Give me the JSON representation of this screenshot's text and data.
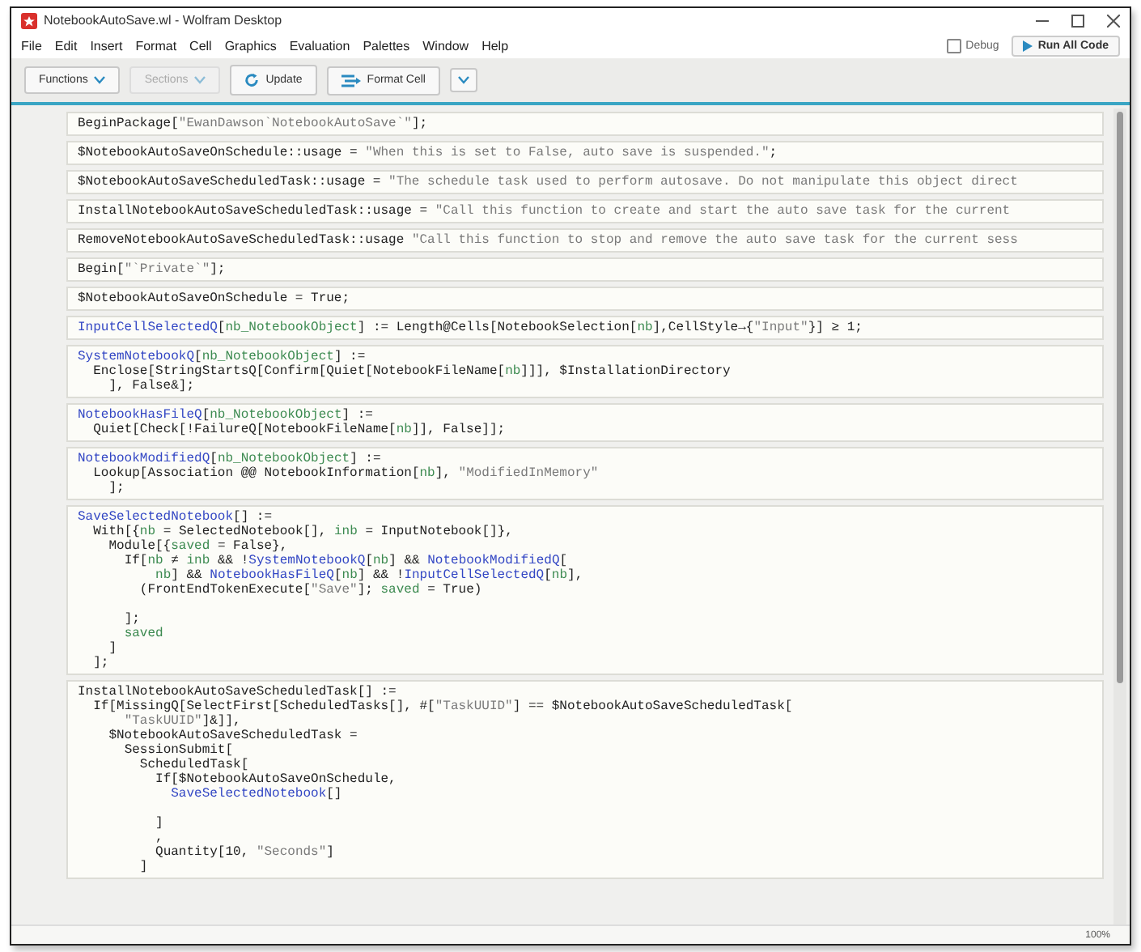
{
  "window": {
    "title": "NotebookAutoSave.wl - Wolfram Desktop"
  },
  "menu": [
    "File",
    "Edit",
    "Insert",
    "Format",
    "Cell",
    "Graphics",
    "Evaluation",
    "Palettes",
    "Window",
    "Help"
  ],
  "toolbar": {
    "buttons": [
      {
        "label": "Functions",
        "kind": "dropdown",
        "disabled": false
      },
      {
        "label": "Sections",
        "kind": "dropdown",
        "disabled": true
      },
      {
        "label": "Update",
        "kind": "refresh",
        "disabled": false
      },
      {
        "label": "Format Cell",
        "kind": "format",
        "disabled": false
      },
      {
        "kind": "chevron",
        "disabled": false
      }
    ],
    "debug": {
      "label": "Debug",
      "checked": false
    },
    "run_button": "Run All Code"
  },
  "cells": [
    {
      "lines": [
        [
          {
            "text": "BeginPackage[",
            "kind": "plain"
          },
          {
            "text": "\"EwanDawson`NotebookAutoSave`\"",
            "kind": "str"
          },
          {
            "text": "];",
            "kind": "plain"
          }
        ]
      ]
    },
    {
      "lines": [
        [
          {
            "text": "$NotebookAutoSaveOnSchedule::usage = ",
            "kind": "plain"
          },
          {
            "text": "\"When this is set to False, auto save is suspended.\"",
            "kind": "str"
          },
          {
            "text": ";",
            "kind": "plain"
          }
        ]
      ]
    },
    {
      "lines": [
        [
          {
            "text": "$NotebookAutoSaveScheduledTask::usage = ",
            "kind": "plain"
          },
          {
            "text": "\"The schedule task used to perform autosave. Do not manipulate this object direct",
            "kind": "str"
          }
        ]
      ]
    },
    {
      "lines": [
        [
          {
            "text": "InstallNotebookAutoSaveScheduledTask::usage = ",
            "kind": "plain"
          },
          {
            "text": "\"Call this function to create and start the auto save task for the current",
            "kind": "str"
          }
        ]
      ]
    },
    {
      "lines": [
        [
          {
            "text": "RemoveNotebookAutoSaveScheduledTask::usage ",
            "kind": "plain"
          },
          {
            "text": "\"Call this function to stop and remove the auto save task for the current sess",
            "kind": "str"
          }
        ]
      ]
    },
    {
      "lines": [
        [
          {
            "text": "Begin[",
            "kind": "plain"
          },
          {
            "text": "\"`Private`\"",
            "kind": "str"
          },
          {
            "text": "];",
            "kind": "plain"
          }
        ]
      ]
    },
    {
      "lines": [
        [
          {
            "text": "$NotebookAutoSaveOnSchedule = True;",
            "kind": "plain"
          }
        ]
      ]
    },
    {
      "lines": [
        [
          {
            "text": "InputCellSelectedQ",
            "kind": "def"
          },
          {
            "text": "[",
            "kind": "plain"
          },
          {
            "text": "nb_NotebookObject",
            "kind": "var"
          },
          {
            "text": "] := Length@Cells[NotebookSelection[",
            "kind": "plain"
          },
          {
            "text": "nb",
            "kind": "var"
          },
          {
            "text": "],CellStyle→{",
            "kind": "plain"
          },
          {
            "text": "\"Input\"",
            "kind": "str"
          },
          {
            "text": "}] ≥ 1;",
            "kind": "plain"
          }
        ]
      ]
    },
    {
      "lines": [
        [
          {
            "text": "SystemNotebookQ",
            "kind": "def"
          },
          {
            "text": "[",
            "kind": "plain"
          },
          {
            "text": "nb_NotebookObject",
            "kind": "var"
          },
          {
            "text": "] :=",
            "kind": "plain"
          }
        ],
        [
          {
            "text": "  Enclose[StringStartsQ[Confirm[Quiet[NotebookFileName[",
            "kind": "plain"
          },
          {
            "text": "nb",
            "kind": "var"
          },
          {
            "text": "]]], $InstallationDirectory",
            "kind": "plain"
          }
        ],
        [
          {
            "text": "    ], False&];",
            "kind": "plain"
          }
        ]
      ]
    },
    {
      "lines": [
        [
          {
            "text": "NotebookHasFileQ",
            "kind": "def"
          },
          {
            "text": "[",
            "kind": "plain"
          },
          {
            "text": "nb_NotebookObject",
            "kind": "var"
          },
          {
            "text": "] :=",
            "kind": "plain"
          }
        ],
        [
          {
            "text": "  Quiet[Check[!FailureQ[NotebookFileName[",
            "kind": "plain"
          },
          {
            "text": "nb",
            "kind": "var"
          },
          {
            "text": "]], False]];",
            "kind": "plain"
          }
        ]
      ]
    },
    {
      "lines": [
        [
          {
            "text": "NotebookModifiedQ",
            "kind": "def"
          },
          {
            "text": "[",
            "kind": "plain"
          },
          {
            "text": "nb_NotebookObject",
            "kind": "var"
          },
          {
            "text": "] :=",
            "kind": "plain"
          }
        ],
        [
          {
            "text": "  Lookup[Association @@ NotebookInformation[",
            "kind": "plain"
          },
          {
            "text": "nb",
            "kind": "var"
          },
          {
            "text": "], ",
            "kind": "plain"
          },
          {
            "text": "\"ModifiedInMemory\"",
            "kind": "str"
          }
        ],
        [
          {
            "text": "    ];",
            "kind": "plain"
          }
        ]
      ]
    },
    {
      "lines": [
        [
          {
            "text": "SaveSelectedNotebook",
            "kind": "def"
          },
          {
            "text": "[] :=",
            "kind": "plain"
          }
        ],
        [
          {
            "text": "  With[{",
            "kind": "plain"
          },
          {
            "text": "nb",
            "kind": "var"
          },
          {
            "text": " = SelectedNotebook[], ",
            "kind": "plain"
          },
          {
            "text": "inb",
            "kind": "var"
          },
          {
            "text": " = InputNotebook[]},",
            "kind": "plain"
          }
        ],
        [
          {
            "text": "    Module[{",
            "kind": "plain"
          },
          {
            "text": "saved",
            "kind": "var"
          },
          {
            "text": " = False},",
            "kind": "plain"
          }
        ],
        [
          {
            "text": "      If[",
            "kind": "plain"
          },
          {
            "text": "nb",
            "kind": "var"
          },
          {
            "text": " ≠ ",
            "kind": "plain"
          },
          {
            "text": "inb",
            "kind": "var"
          },
          {
            "text": " && !",
            "kind": "plain"
          },
          {
            "text": "SystemNotebookQ",
            "kind": "def"
          },
          {
            "text": "[",
            "kind": "plain"
          },
          {
            "text": "nb",
            "kind": "var"
          },
          {
            "text": "] && ",
            "kind": "plain"
          },
          {
            "text": "NotebookModifiedQ",
            "kind": "def"
          },
          {
            "text": "[",
            "kind": "plain"
          }
        ],
        [
          {
            "text": "          nb",
            "kind": "var"
          },
          {
            "text": "] && ",
            "kind": "plain"
          },
          {
            "text": "NotebookHasFileQ",
            "kind": "def"
          },
          {
            "text": "[",
            "kind": "plain"
          },
          {
            "text": "nb",
            "kind": "var"
          },
          {
            "text": "] && !",
            "kind": "plain"
          },
          {
            "text": "InputCellSelectedQ",
            "kind": "def"
          },
          {
            "text": "[",
            "kind": "plain"
          },
          {
            "text": "nb",
            "kind": "var"
          },
          {
            "text": "],",
            "kind": "plain"
          }
        ],
        [
          {
            "text": "        (FrontEndTokenExecute[",
            "kind": "plain"
          },
          {
            "text": "\"Save\"",
            "kind": "str"
          },
          {
            "text": "]; ",
            "kind": "plain"
          },
          {
            "text": "saved",
            "kind": "var"
          },
          {
            "text": " = True)",
            "kind": "plain"
          }
        ],
        [
          {
            "kind": "blank"
          }
        ],
        [
          {
            "text": "      ];",
            "kind": "plain"
          }
        ],
        [
          {
            "text": "      saved",
            "kind": "var"
          }
        ],
        [
          {
            "text": "    ]",
            "kind": "plain"
          }
        ],
        [
          {
            "text": "  ];",
            "kind": "plain"
          }
        ]
      ]
    },
    {
      "lines": [
        [
          {
            "text": "InstallNotebookAutoSaveScheduledTask[] :=",
            "kind": "plain"
          }
        ],
        [
          {
            "text": "  If[MissingQ[SelectFirst[ScheduledTasks[], #[",
            "kind": "plain"
          },
          {
            "text": "\"TaskUUID\"",
            "kind": "str"
          },
          {
            "text": "] == $NotebookAutoSaveScheduledTask[",
            "kind": "plain"
          }
        ],
        [
          {
            "text": "      \"TaskUUID\"",
            "kind": "str"
          },
          {
            "text": "]&]],",
            "kind": "plain"
          }
        ],
        [
          {
            "text": "    $NotebookAutoSaveScheduledTask =",
            "kind": "plain"
          }
        ],
        [
          {
            "text": "      SessionSubmit[",
            "kind": "plain"
          }
        ],
        [
          {
            "text": "        ScheduledTask[",
            "kind": "plain"
          }
        ],
        [
          {
            "text": "          If[$NotebookAutoSaveOnSchedule,",
            "kind": "plain"
          }
        ],
        [
          {
            "text": "            SaveSelectedNotebook",
            "kind": "def"
          },
          {
            "text": "[]",
            "kind": "plain"
          }
        ],
        [
          {
            "kind": "blank"
          }
        ],
        [
          {
            "text": "          ]",
            "kind": "plain"
          }
        ],
        [
          {
            "text": "          ,",
            "kind": "plain"
          }
        ],
        [
          {
            "text": "          Quantity[10, ",
            "kind": "plain"
          },
          {
            "text": "\"Seconds\"",
            "kind": "str"
          },
          {
            "text": "]",
            "kind": "plain"
          }
        ],
        [
          {
            "text": "        ]",
            "kind": "plain"
          }
        ]
      ]
    }
  ],
  "status_bar": {
    "zoom": "100%"
  }
}
